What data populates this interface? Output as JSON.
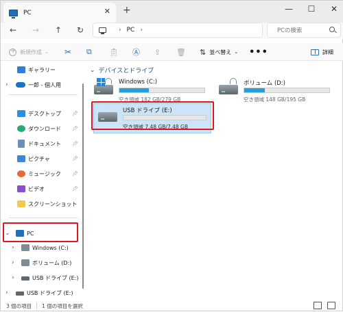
{
  "window": {
    "tab_title": "PC",
    "tab_close": "✕",
    "new_tab": "+",
    "controls": [
      "—",
      "☐",
      "✕"
    ]
  },
  "nav": {
    "back": "←",
    "forward": "→",
    "up": "↑",
    "refresh": "↻",
    "breadcrumb": [
      "PC"
    ],
    "search_placeholder": "PCの検索"
  },
  "command_bar": {
    "new_label": "新規作成",
    "sort_label": "並べ替え",
    "more_label": "•••",
    "details_label": "詳細"
  },
  "sidebar": {
    "top_items": [
      {
        "label": "ギャラリー",
        "icon": "gallery-icon"
      },
      {
        "label": "一郎 - 個人用",
        "icon": "cloud-icon",
        "expandable": true
      }
    ],
    "quick_access": [
      {
        "label": "デスクトップ",
        "icon": "desktop-icon",
        "pinned": true
      },
      {
        "label": "ダウンロード",
        "icon": "download-icon",
        "pinned": true
      },
      {
        "label": "ドキュメント",
        "icon": "document-icon",
        "pinned": true
      },
      {
        "label": "ピクチャ",
        "icon": "pictures-icon",
        "pinned": true
      },
      {
        "label": "ミュージック",
        "icon": "music-icon",
        "pinned": true
      },
      {
        "label": "ビデオ",
        "icon": "video-icon",
        "pinned": true
      },
      {
        "label": "スクリーンショット",
        "icon": "folder-icon",
        "pinned": false
      }
    ],
    "pc": {
      "label": "PC",
      "expanded": true
    },
    "pc_children": [
      {
        "label": "Windows (C:)",
        "icon": "windows-drive-icon"
      },
      {
        "label": "ボリューム (D:)",
        "icon": "drive-icon"
      },
      {
        "label": "USB ドライブ (E:)",
        "icon": "usb-drive-icon"
      }
    ],
    "usb_root": {
      "label": "USB ドライブ (E:)",
      "icon": "usb-drive-icon"
    }
  },
  "main": {
    "section_title": "デバイスとドライブ",
    "drives": [
      {
        "name": "Windows (C:)",
        "info": "空き領域 182 GB/279 GB",
        "used_fraction": 0.35,
        "selected": false
      },
      {
        "name": "ボリューム (D:)",
        "info": "空き領域 148 GB/195 GB",
        "used_fraction": 0.24,
        "selected": false
      },
      {
        "name": "USB ドライブ (E:)",
        "info": "空き領域 7.48 GB/7.48 GB",
        "used_fraction": 0.0,
        "selected": true
      }
    ]
  },
  "status": {
    "item_count": "3 個の項目",
    "selected_count": "1 個の項目を選択"
  },
  "colors": {
    "accent": "#26a0da",
    "selection": "#cce4f7",
    "highlight_box": "#e0141e"
  }
}
